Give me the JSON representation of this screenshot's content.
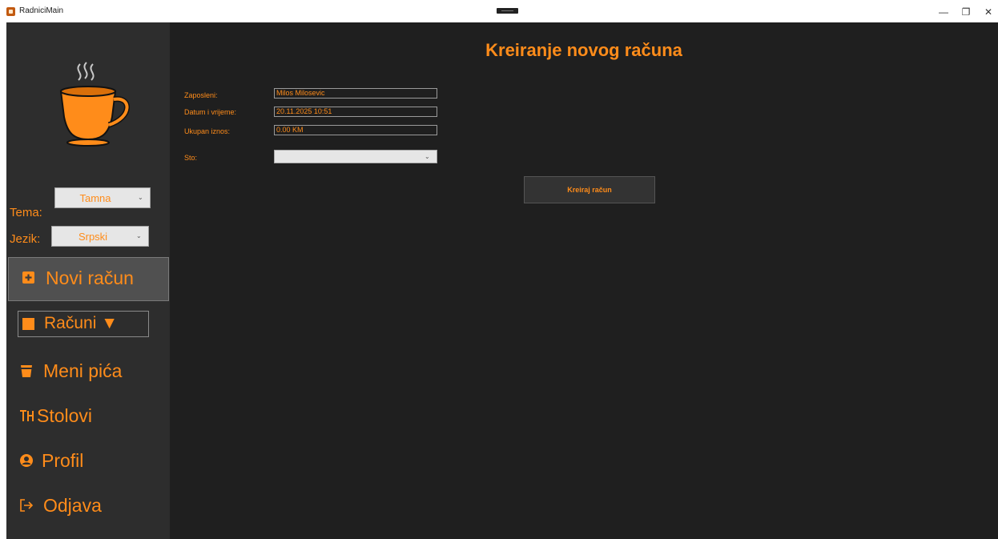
{
  "window": {
    "title": "RadniciMain",
    "minimize_glyph": "—",
    "restore_glyph": "❐",
    "close_glyph": "✕"
  },
  "sidebar": {
    "logo_icon": "coffee-cup-icon",
    "theme": {
      "label": "Tema:",
      "value": "Tamna"
    },
    "language": {
      "label": "Jezik:",
      "value": "Srpski"
    },
    "nav": {
      "new_invoice": {
        "label": "Novi račun",
        "icon": "plus-square-icon"
      },
      "invoices": {
        "label": "Računi ▼",
        "icon": "receipt-icon"
      },
      "drinks_menu": {
        "label": "Meni pića",
        "icon": "cup-icon"
      },
      "tables": {
        "label": "Stolovi",
        "icon": "table-icon"
      },
      "profile": {
        "label": "Profil",
        "icon": "user-circle-icon"
      },
      "logout": {
        "label": "Odjava",
        "icon": "logout-icon"
      }
    }
  },
  "main": {
    "title": "Kreiranje novog računa",
    "form": {
      "employee": {
        "label": "Zaposleni:",
        "value": "Milos Milosevic"
      },
      "datetime": {
        "label": "Datum i vrijeme:",
        "value": "20.11.2025 10:51"
      },
      "total": {
        "label": "Ukupan iznos:",
        "value": "0.00 KM"
      },
      "table": {
        "label": "Sto:",
        "value": ""
      }
    },
    "create_button": "Kreiraj račun"
  },
  "colors": {
    "accent": "#ff8c1a",
    "sidebar_bg": "#2d2d2d",
    "main_bg": "#1f1f1f"
  }
}
